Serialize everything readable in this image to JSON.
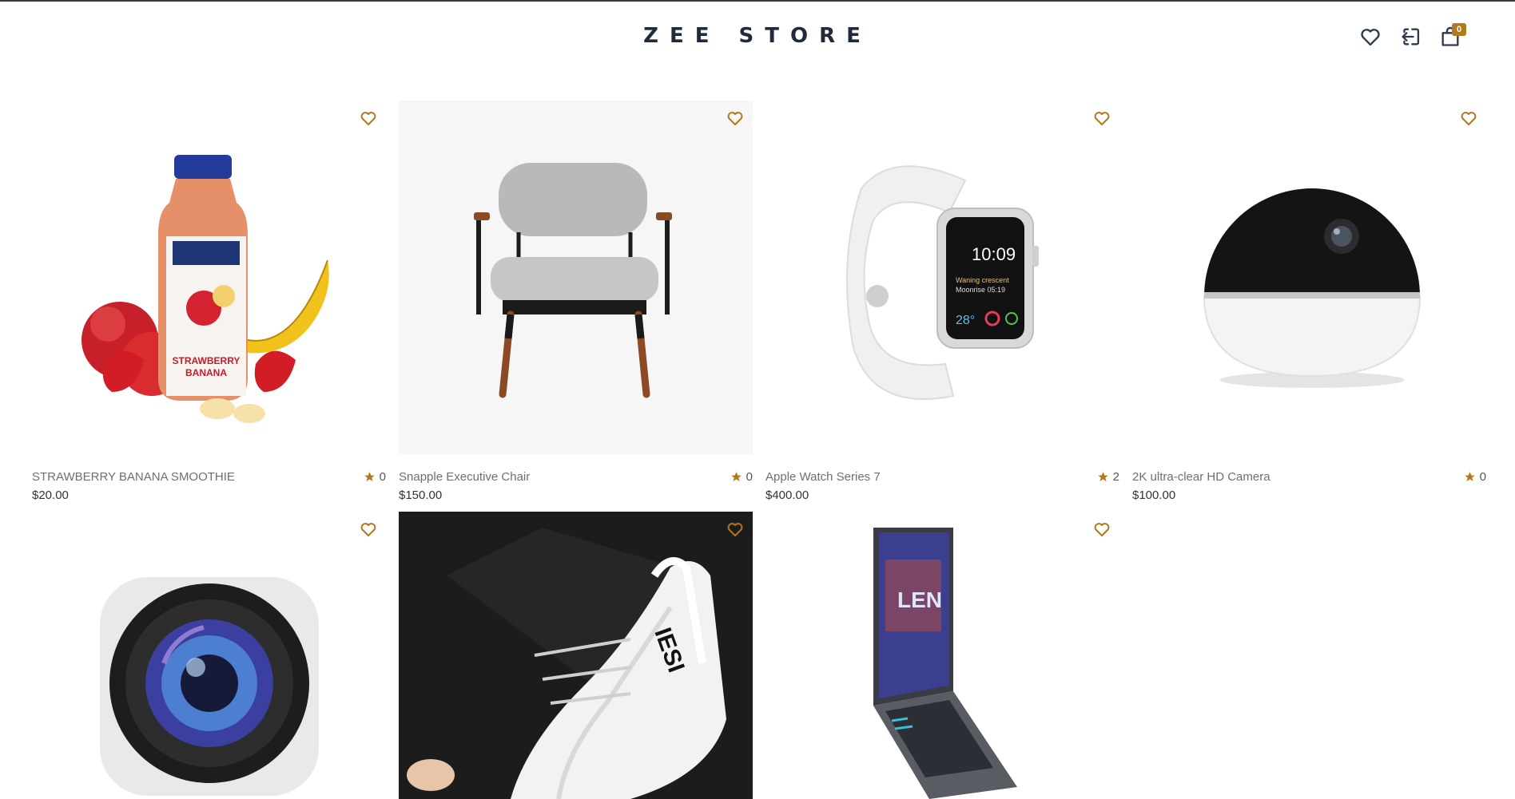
{
  "header": {
    "brand": "ZEE STORE",
    "icons": [
      "heart-icon",
      "login-icon",
      "shopping-bag-icon"
    ],
    "cart_count": "0"
  },
  "colors": {
    "accent": "#b0791a",
    "brand_text": "#1f2a3a"
  },
  "products": [
    {
      "name": "STRAWBERRY BANANA SMOOTHIE",
      "price": "$20.00",
      "rating": "0"
    },
    {
      "name": "Snapple Executive Chair",
      "price": "$150.00",
      "rating": "0"
    },
    {
      "name": "Apple Watch Series 7",
      "price": "$400.00",
      "rating": "2"
    },
    {
      "name": "2K ultra-clear HD Camera",
      "price": "$100.00",
      "rating": "0"
    },
    {
      "name": "",
      "price": "",
      "rating": ""
    },
    {
      "name": "",
      "price": "",
      "rating": ""
    },
    {
      "name": "",
      "price": "",
      "rating": ""
    }
  ]
}
